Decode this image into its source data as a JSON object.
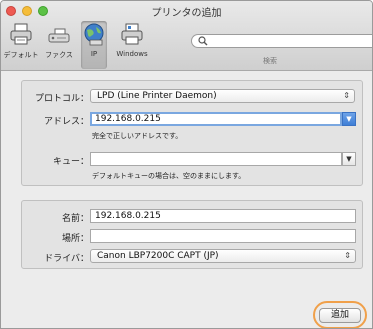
{
  "window": {
    "title": "プリンタの追加"
  },
  "toolbar": {
    "items": [
      {
        "label": "デフォルト",
        "icon": "printer-default-icon"
      },
      {
        "label": "ファクス",
        "icon": "fax-icon"
      },
      {
        "label": "IP",
        "icon": "globe-ip-icon",
        "selected": true
      },
      {
        "label": "Windows",
        "icon": "printer-windows-icon"
      }
    ],
    "search_caption": "検索",
    "search_placeholder": ""
  },
  "form": {
    "protocol": {
      "label": "プロトコル：",
      "value": "LPD (Line Printer Daemon)"
    },
    "address": {
      "label": "アドレス：",
      "value": "192.168.0.215",
      "hint": "完全で正しいアドレスです。"
    },
    "queue": {
      "label": "キュー：",
      "value": "",
      "hint": "デフォルトキューの場合は、空のままにします。"
    },
    "name": {
      "label": "名前：",
      "value": "192.168.0.215"
    },
    "location": {
      "label": "場所：",
      "value": ""
    },
    "driver": {
      "label": "ドライバ：",
      "value": "Canon LBP7200C CAPT (JP)"
    }
  },
  "actions": {
    "add_label": "追加"
  },
  "colors": {
    "accent_focus": "#7aa7e0",
    "highlight_ring": "#f0a04a"
  }
}
